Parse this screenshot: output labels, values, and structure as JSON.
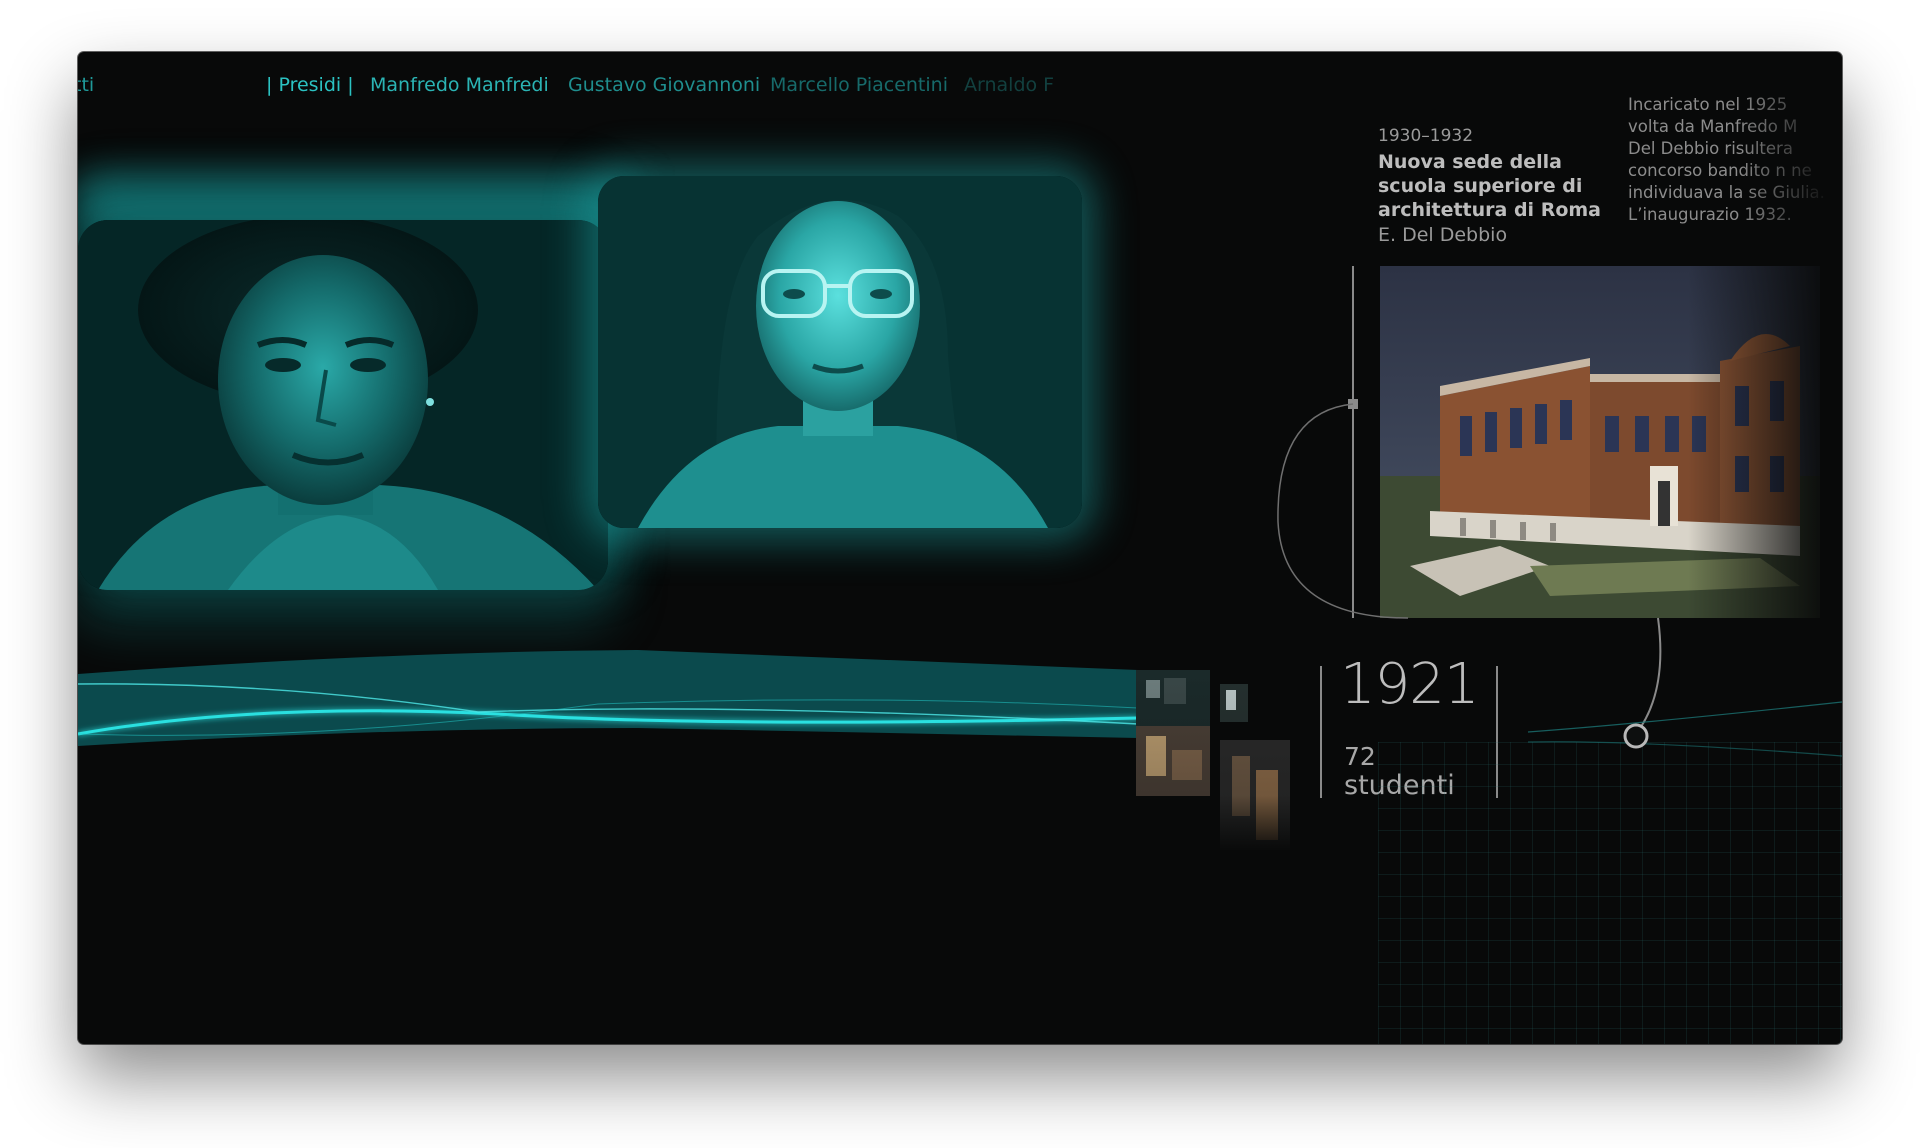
{
  "nav": {
    "prev": "tti",
    "current": "| Presidi |",
    "items": [
      "Manfredo Manfredi",
      "Gustavo Giovannoni",
      "Marcello Piacentini",
      "Arnaldo F"
    ]
  },
  "project": {
    "date": "1930–1932",
    "title": "Nuova sede della scuola superiore di architettura di Roma",
    "author": "E. Del Debbio",
    "description": "Incaricato nel 1925 volta da Manfredo M Del Debbio risultera concorso bandito n ne individuava la se Giulia. L’inaugurazio 1932."
  },
  "stats": {
    "year": "1921",
    "count": "72",
    "label": "studenti"
  },
  "colors": {
    "accent": "#1fd6d6",
    "band": "#0a4a4c",
    "background": "#080909"
  },
  "icons": {
    "timeline_marker": "timeline-dot-icon"
  }
}
